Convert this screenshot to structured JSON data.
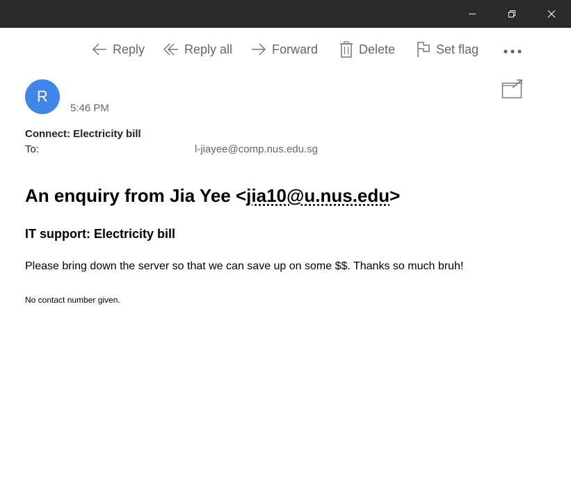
{
  "window_controls": {
    "minimize_icon": "minimize-icon",
    "maximize_icon": "restore-icon",
    "close_icon": "close-icon"
  },
  "toolbar": {
    "reply_label": "Reply",
    "reply_all_label": "Reply all",
    "forward_label": "Forward",
    "delete_label": "Delete",
    "set_flag_label": "Set flag",
    "more_icon": "ellipsis-icon"
  },
  "message": {
    "sender_initial": "R",
    "time": "5:46 PM",
    "subject": "Connect: Electricity bill",
    "to_label": "To:",
    "to_address": "l-jiayee@comp.nus.edu.sg"
  },
  "body": {
    "heading_prefix": "An enquiry from Jia Yee <",
    "heading_email": "jia10@u.nus.edu",
    "heading_suffix": ">",
    "subheading": "IT support: Electricity bill",
    "paragraph": "Please bring down the server so that we can save up on some $$. Thanks so much bruh!",
    "note": "No contact number given."
  },
  "colors": {
    "titlebar": "#2b2b2b",
    "avatar": "#3f86e8",
    "muted_text": "#666666"
  }
}
